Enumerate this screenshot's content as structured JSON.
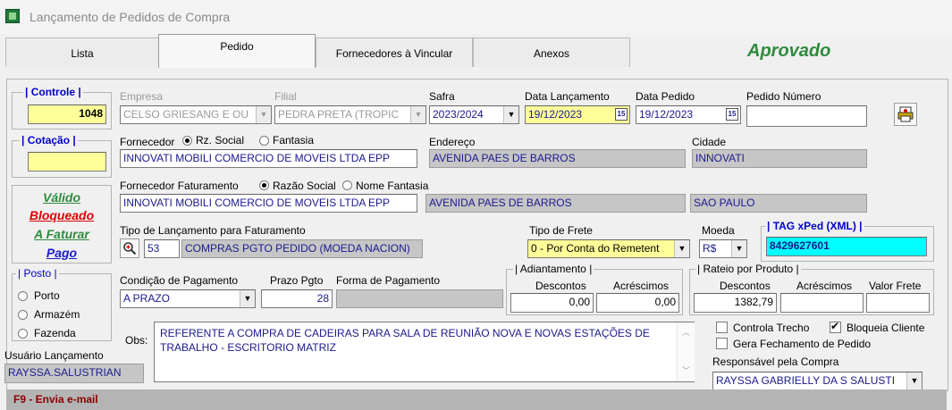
{
  "window": {
    "title": "Lançamento de Pedidos de Compra"
  },
  "tabs": {
    "lista": "Lista",
    "pedido": "Pedido",
    "fornecedores": "Fornecedores à Vincular",
    "anexos": "Anexos"
  },
  "status": {
    "text": "Aprovado",
    "color": "#2e8b3d"
  },
  "controle": {
    "label": "Controle",
    "value": "1048"
  },
  "cotacao": {
    "label": "Cotação",
    "value": ""
  },
  "empresa": {
    "label": "Empresa",
    "value": "CELSO GRIESANG E OU"
  },
  "filial": {
    "label": "Filial",
    "value": "PEDRA PRETA (TROPIC"
  },
  "safra": {
    "label": "Safra",
    "value": "2023/2024"
  },
  "data_lancamento": {
    "label": "Data Lançamento",
    "value": "19/12/2023"
  },
  "data_pedido": {
    "label": "Data Pedido",
    "value": "19/12/2023"
  },
  "pedido_numero": {
    "label": "Pedido Número",
    "value": ""
  },
  "fornecedor": {
    "label": "Fornecedor",
    "opt1": "Rz. Social",
    "opt2": "Fantasia",
    "value": "INNOVATI MOBILI COMERCIO DE MOVEIS LTDA EPP"
  },
  "endereco": {
    "label": "Endereço",
    "value": "AVENIDA PAES DE BARROS"
  },
  "cidade": {
    "label": "Cidade",
    "value": "INNOVATI"
  },
  "status_links": {
    "valido": "Válido",
    "bloqueado": "Bloqueado",
    "a_faturar": "A Faturar",
    "pago": "Pago"
  },
  "forn_faturamento": {
    "label": "Fornecedor Faturamento",
    "opt1": "Razão Social",
    "opt2": "Nome Fantasia",
    "value": "INNOVATI MOBILI COMERCIO DE MOVEIS LTDA EPP",
    "endereco": "AVENIDA PAES DE BARROS",
    "cidade": "SAO PAULO"
  },
  "tipo_lancamento": {
    "label": "Tipo de Lançamento para Faturamento",
    "code": "53",
    "value": "COMPRAS PGTO PEDIDO (MOEDA NACION)"
  },
  "tipo_frete": {
    "label": "Tipo de Frete",
    "value": "0 - Por Conta do Remetent"
  },
  "moeda": {
    "label": "Moeda",
    "value": "R$"
  },
  "tag_xped": {
    "label": "TAG xPed (XML)",
    "value": "8429627601"
  },
  "posto": {
    "label": "Posto",
    "opt1": "Porto",
    "opt2": "Armazém",
    "opt3": "Fazenda"
  },
  "condicao_pagamento": {
    "label": "Condição de Pagamento",
    "value": "A PRAZO"
  },
  "prazo_pgto": {
    "label": "Prazo Pgto",
    "value": "28"
  },
  "forma_pagamento": {
    "label": "Forma de Pagamento",
    "value": ""
  },
  "adiantamento": {
    "label": "Adiantamento",
    "descontos_label": "Descontos",
    "acrescimos_label": "Acréscimos",
    "descontos": "0,00",
    "acrescimos": "0,00"
  },
  "rateio": {
    "label": "Rateio por Produto",
    "descontos_label": "Descontos",
    "acrescimos_label": "Acréscimos",
    "frete_label": "Valor Frete",
    "descontos": "1382,79",
    "acrescimos": "",
    "frete": ""
  },
  "obs": {
    "label": "Obs:",
    "value": "REFERENTE A COMPRA DE CADEIRAS PARA SALA DE REUNIÃO NOVA E NOVAS ESTAÇÕES DE TRABALHO - ESCRITORIO MATRIZ"
  },
  "usuario": {
    "label": "Usuário Lançamento",
    "value": "RAYSSA.SALUSTRIAN"
  },
  "checks": {
    "controla_trecho": "Controla Trecho",
    "bloqueia_cliente": "Bloqueia Cliente",
    "gera_fechamento": "Gera Fechamento de Pedido"
  },
  "responsavel": {
    "label": "Responsável pela Compra",
    "value": "RAYSSA GABRIELLY DA S SALUSTI"
  },
  "footer": {
    "text": "F9 - Envia e-mail"
  }
}
